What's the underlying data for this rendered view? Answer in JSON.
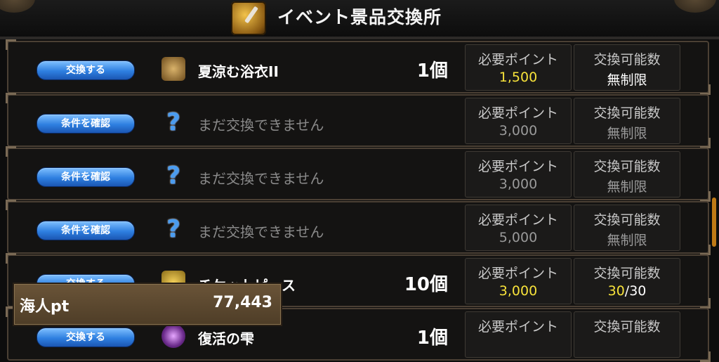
{
  "header": {
    "title": "イベント景品交換所"
  },
  "columns": {
    "points_label": "必要ポイント",
    "limit_label": "交換可能数"
  },
  "rows": [
    {
      "button": "交換する",
      "icon": "yukata-icon",
      "name": "夏涼む浴衣II",
      "qty": "1個",
      "points": "1,500",
      "limit": "無制限",
      "locked": false
    },
    {
      "button": "条件を確認",
      "icon": "question-icon",
      "name": "まだ交換できません",
      "qty": "",
      "points": "3,000",
      "limit": "無制限",
      "locked": true
    },
    {
      "button": "条件を確認",
      "icon": "question-icon",
      "name": "まだ交換できません",
      "qty": "",
      "points": "3,000",
      "limit": "無制限",
      "locked": true
    },
    {
      "button": "条件を確認",
      "icon": "question-icon",
      "name": "まだ交換できません",
      "qty": "",
      "points": "5,000",
      "limit": "無制限",
      "locked": true
    },
    {
      "button": "交換する",
      "icon": "ticket-icon",
      "name": "チケットピース",
      "qty": "10個",
      "points": "3,000",
      "limit_current": "30",
      "limit_total": "/30",
      "locked": false
    },
    {
      "button": "交換する",
      "icon": "drop-icon",
      "name": "復活の雫",
      "qty": "1個",
      "points": "",
      "limit": "",
      "locked": false
    }
  ],
  "points_panel": {
    "label": "海人pt",
    "value": "77,443"
  },
  "colors": {
    "accent_yellow": "#f7e23a",
    "button_blue": "#2e7fe0",
    "locked_grey": "#9a9a9a"
  }
}
